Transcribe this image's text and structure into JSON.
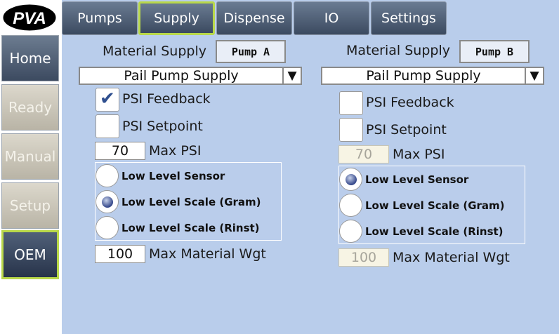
{
  "logo": {
    "text": "PVA"
  },
  "sidebar": {
    "items": [
      {
        "label": "Home"
      },
      {
        "label": "Ready"
      },
      {
        "label": "Manual"
      },
      {
        "label": "Setup"
      },
      {
        "label": "OEM"
      }
    ]
  },
  "tabs": [
    {
      "label": "Pumps"
    },
    {
      "label": "Supply"
    },
    {
      "label": "Dispense"
    },
    {
      "label": "IO"
    },
    {
      "label": "Settings"
    }
  ],
  "active_tab": "Supply",
  "colors": {
    "accent_highlight": "#b9d84a",
    "panel_bg": "#b9cdeb"
  },
  "panel_a": {
    "material_supply_label": "Material Supply",
    "pump_name": "Pump A",
    "supply_type": "Pail Pump Supply",
    "dropdown_arrow": "▼",
    "psi_feedback_label": "PSI Feedback",
    "psi_feedback_checked": true,
    "checkmark": "✔",
    "psi_setpoint_label": "PSI Setpoint",
    "psi_setpoint_checked": false,
    "max_psi_value": "70",
    "max_psi_label": "Max PSI",
    "low_level_options": [
      "Low Level Sensor",
      "Low Level Scale (Gram)",
      "Low Level Scale (Rinst)"
    ],
    "low_level_selected": "Low Level Scale (Gram)",
    "max_material_value": "100",
    "max_material_label": "Max Material Wgt"
  },
  "panel_b": {
    "material_supply_label": "Material Supply",
    "pump_name": "Pump B",
    "supply_type": "Pail Pump Supply",
    "dropdown_arrow": "▼",
    "psi_feedback_label": "PSI Feedback",
    "psi_feedback_checked": false,
    "psi_setpoint_label": "PSI Setpoint",
    "psi_setpoint_checked": false,
    "max_psi_value": "70",
    "max_psi_label": "Max PSI",
    "low_level_options": [
      "Low Level Sensor",
      "Low Level Scale (Gram)",
      "Low Level Scale (Rinst)"
    ],
    "low_level_selected": "Low Level Sensor",
    "max_material_value": "100",
    "max_material_label": "Max Material Wgt"
  }
}
